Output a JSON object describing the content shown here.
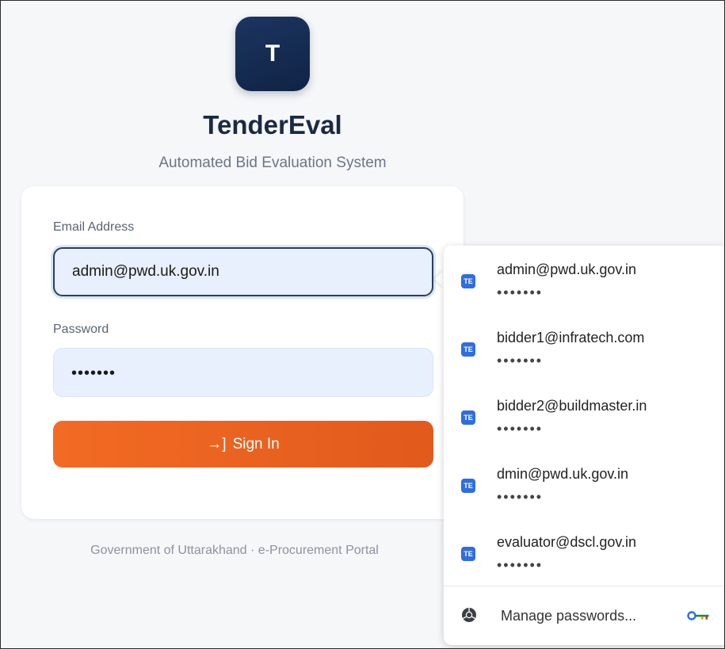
{
  "brand": {
    "logo_letter": "T",
    "title": "TenderEval",
    "subtitle": "Automated Bid Evaluation System"
  },
  "form": {
    "email_label": "Email Address",
    "email_value": "admin@pwd.uk.gov.in",
    "password_label": "Password",
    "password_value": "•••••••",
    "signin_icon": "→]",
    "signin_label": "Sign In"
  },
  "footer": {
    "text": "Government of Uttarakhand · e-Procurement Portal"
  },
  "autofill": {
    "badge": "TE",
    "credentials": [
      {
        "username": "admin@pwd.uk.gov.in",
        "password": "•••••••"
      },
      {
        "username": "bidder1@infratech.com",
        "password": "•••••••"
      },
      {
        "username": "bidder2@buildmaster.in",
        "password": "•••••••"
      },
      {
        "username": "dmin@pwd.uk.gov.in",
        "password": "•••••••"
      },
      {
        "username": "evaluator@dscl.gov.in",
        "password": "•••••••"
      }
    ],
    "manage_label": "Manage passwords..."
  },
  "colors": {
    "brand_navy": "#1c3560",
    "signin_orange": "#f26b24",
    "badge_blue": "#2f6de1"
  }
}
